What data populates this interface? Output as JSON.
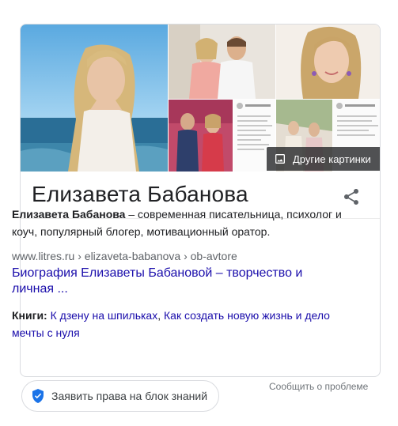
{
  "knowledge_panel": {
    "title": "Елизавета Бабанова",
    "more_images_label": "Другие картинки",
    "description": {
      "bold_name": "Елизавета Бабанова",
      "text": " – современная писательница, психолог и коуч, популярный блогер, мотивационный оратор."
    },
    "source": {
      "cite": "www.litres.ru › elizaveta-babanova › ob-avtore",
      "link_text": "Биография Елизаветы Бабановой – творчество и личная ..."
    },
    "books": {
      "label": "Книги:",
      "item1": "К дзену на шпильках",
      "separator": ", ",
      "item2": "Как создать новую жизнь и дело мечты с нуля"
    }
  },
  "footer": {
    "claim_label": "Заявить права на блок знаний",
    "report_label": "Сообщить о проблеме"
  },
  "icons": [
    "image-icon",
    "share-icon",
    "verified-shield-icon"
  ],
  "colors": {
    "link": "#1a0dab",
    "border": "#dadce0",
    "text": "#202124",
    "muted": "#70757a",
    "badge": "#1a73e8"
  }
}
